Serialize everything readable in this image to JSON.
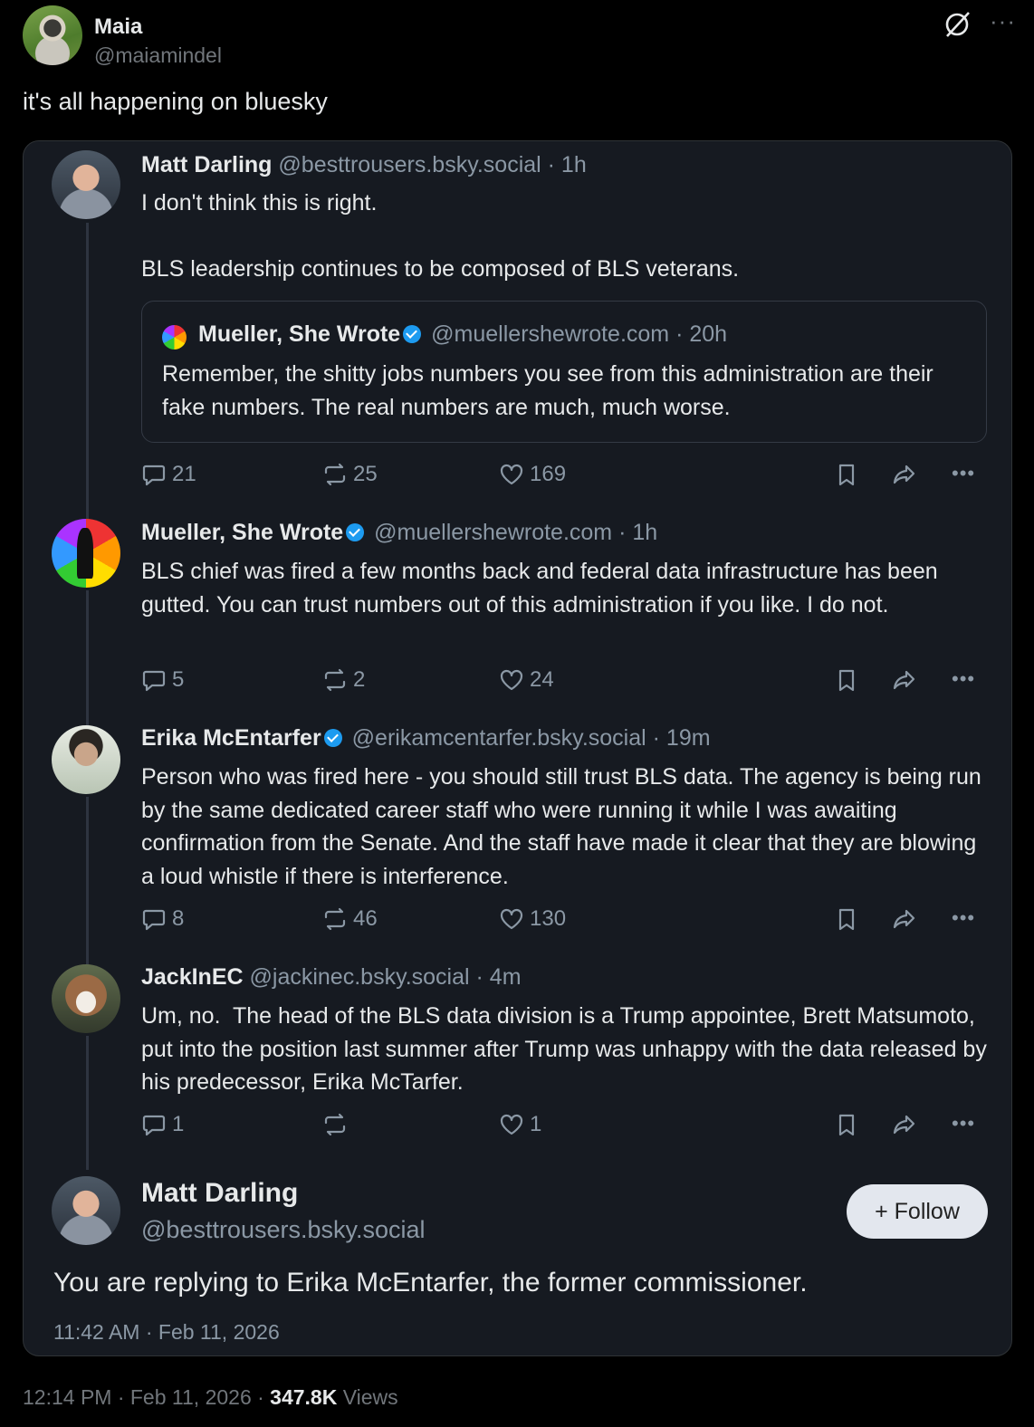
{
  "author": {
    "name": "Maia",
    "handle": "@maiamindel"
  },
  "post_text": "it's all happening on bluesky",
  "thread": [
    {
      "name": "Matt Darling",
      "handle": "@besttrousers.bsky.social",
      "time": "· 1h",
      "verified": false,
      "text": "I don't think this is right.\n\nBLS leadership continues to be composed of BLS veterans.",
      "quote": {
        "name": "Mueller, She Wrote",
        "handle": "@muellershewrote.com",
        "time": "· 20h",
        "text": "Remember, the shitty jobs numbers you see from this administration are their fake numbers. The real numbers are much, much worse."
      },
      "stats": {
        "replies": "21",
        "reposts": "25",
        "likes": "169"
      }
    },
    {
      "name": "Mueller, She Wrote",
      "handle": "@muellershewrote.com",
      "time": "· 1h",
      "verified": true,
      "text": "BLS chief was fired a few months back and federal data infrastructure has been gutted. You can trust numbers out of this administration if you like. I do not.",
      "stats": {
        "replies": "5",
        "reposts": "2",
        "likes": "24"
      }
    },
    {
      "name": "Erika McEntarfer",
      "handle": "@erikamcentarfer.bsky.social",
      "time": "· 19m",
      "verified": true,
      "text": "Person who was fired here - you should still trust BLS data. The agency is being run by the same dedicated career staff who were running it while I was awaiting confirmation from the Senate. And the staff have made it clear that they are blowing a loud whistle if there is interference.",
      "stats": {
        "replies": "8",
        "reposts": "46",
        "likes": "130"
      }
    },
    {
      "name": "JackInEC",
      "handle": "@jackinec.bsky.social",
      "time": "· 4m",
      "verified": false,
      "text": "Um, no.  The head of the BLS data division is a Trump appointee, Brett Matsumoto, put into the position last summer after Trump was unhappy with the data released by his predecessor, Erika McTarfer.",
      "stats": {
        "replies": "1",
        "reposts": "",
        "likes": "1"
      }
    }
  ],
  "focused": {
    "name": "Matt Darling",
    "handle": "@besttrousers.bsky.social",
    "follow_label": "+ Follow",
    "text": "You are replying to Erika McEntarfer, the former commissioner.",
    "timestamp": "11:42 AM · Feb 11, 2026"
  },
  "footer": {
    "time": "12:14 PM · Feb 11, 2026 · ",
    "views_count": "347.8K",
    "views_label": " Views"
  },
  "colors": {
    "card_bg": "#161a21",
    "verified": "#1d9bf0",
    "muted": "#8b98a5"
  }
}
